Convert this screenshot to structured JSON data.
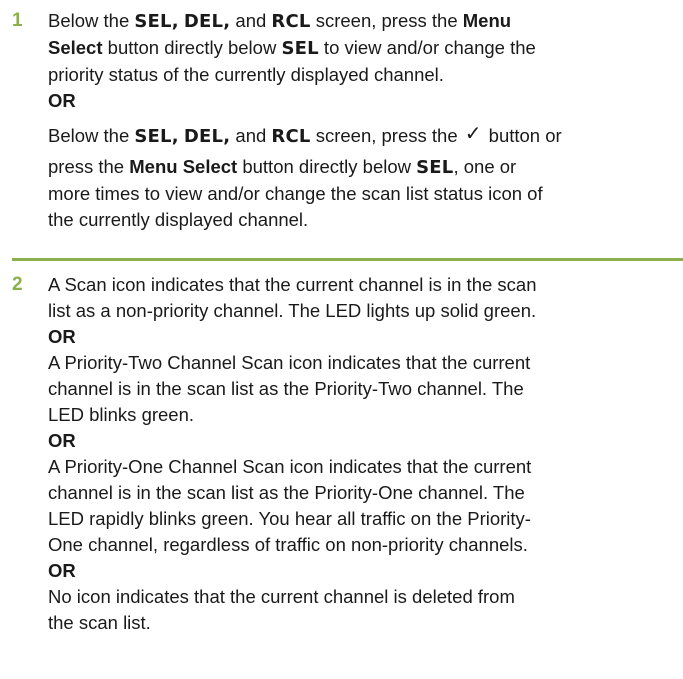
{
  "colors": {
    "accent": "#8ab04b",
    "text": "#1a1a1a"
  },
  "step1": {
    "number": "1",
    "p1": {
      "l1_pre": "Below the ",
      "sel": "SEL,",
      "del": "DEL,",
      "and": " and ",
      "rcl": "RCL",
      "l1_mid": " screen, press the ",
      "menu": "Menu",
      "l2_select": "Select",
      "l2_text": " button directly below ",
      "l2_sel": "SEL",
      "l2_end": " to view and/or change the",
      "l3": "priority status of the currently displayed channel."
    },
    "or1": "OR",
    "p2": {
      "l1_pre": "Below the ",
      "sel": "SEL,",
      "del": "DEL,",
      "and": " and ",
      "rcl": "RCL",
      "l1_mid": " screen, press the ",
      "check_icon": "checkmark-icon",
      "l1_end": " button or",
      "l2_pre": "press the ",
      "menu_select": "Menu Select",
      "l2_mid": " button directly below ",
      "l2_sel": "SEL",
      "l2_end": ", one or",
      "l3": "more times to view and/or change the scan list status icon of",
      "l4": "the currently displayed channel."
    }
  },
  "step2": {
    "number": "2",
    "lines_a": [
      "A Scan icon indicates that the current channel is in the scan",
      "list as a non-priority channel. The LED lights up solid green."
    ],
    "or1": "OR",
    "lines_b": [
      "A Priority-Two Channel Scan icon indicates that the current",
      "channel is in the scan list as the Priority-Two channel. The",
      "LED blinks green."
    ],
    "or2": "OR",
    "lines_c": [
      "A Priority-One Channel Scan icon indicates that the current",
      "channel is in the scan list as the Priority-One channel. The",
      "LED rapidly blinks green. You hear all traffic on the Priority-",
      "One channel, regardless of traffic on non-priority channels."
    ],
    "or3": "OR",
    "lines_d": [
      "No icon indicates that the current channel is deleted from",
      "the scan list."
    ]
  }
}
